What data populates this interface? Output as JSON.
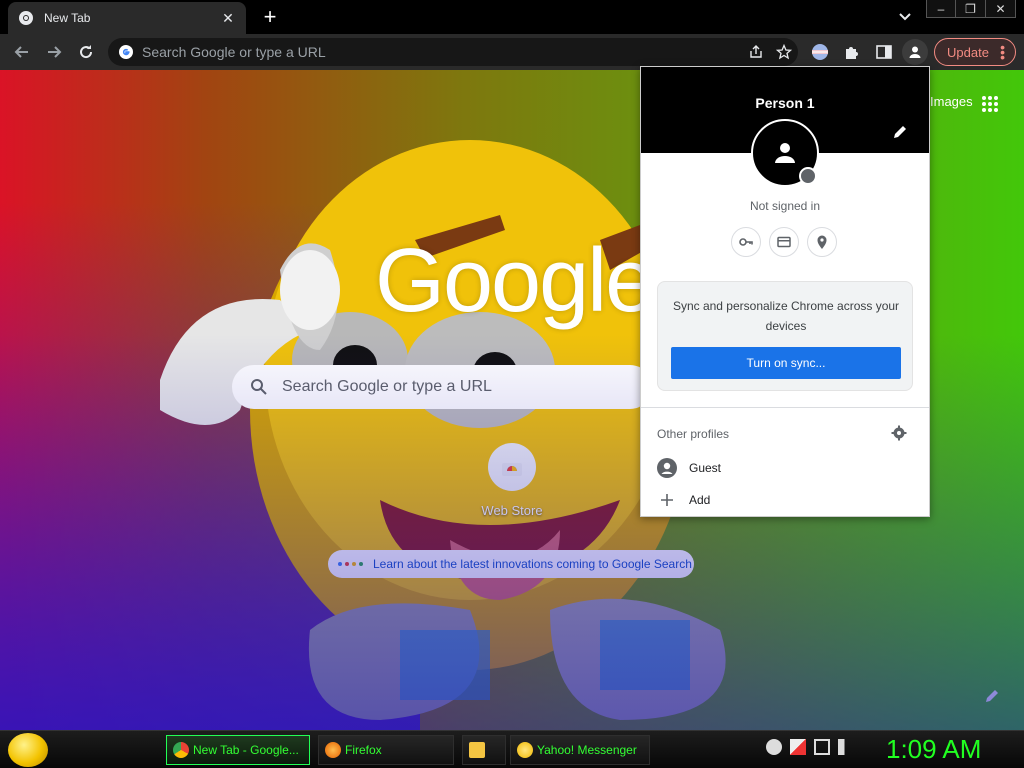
{
  "tabbar": {
    "tab_title": "New Tab",
    "window_controls": [
      "–",
      "❐",
      "✕"
    ]
  },
  "toolbar": {
    "omnibox_placeholder": "Search Google or type a URL",
    "update_label": "Update"
  },
  "ntp": {
    "logo": "Google",
    "search_placeholder": "Search Google or type a URL",
    "shortcut_label": "Web Store",
    "promo_text": "Learn about the latest innovations coming to Google Search",
    "images_label": "Images"
  },
  "profile_popup": {
    "name": "Person 1",
    "status": "Not signed in",
    "sync_text": "Sync and personalize Chrome across your devices",
    "sync_button": "Turn on sync...",
    "other_profiles_label": "Other profiles",
    "guest_label": "Guest",
    "add_label": "Add"
  },
  "taskbar": {
    "tasks": [
      {
        "label": "New Tab - Google..."
      },
      {
        "label": "Firefox"
      },
      {
        "label": ""
      },
      {
        "label": "Yahoo! Messenger"
      }
    ],
    "clock": "1:09 AM"
  },
  "colors": {
    "accent": "#1a73e8",
    "update": "#f28b82",
    "clock": "#21ff21"
  }
}
